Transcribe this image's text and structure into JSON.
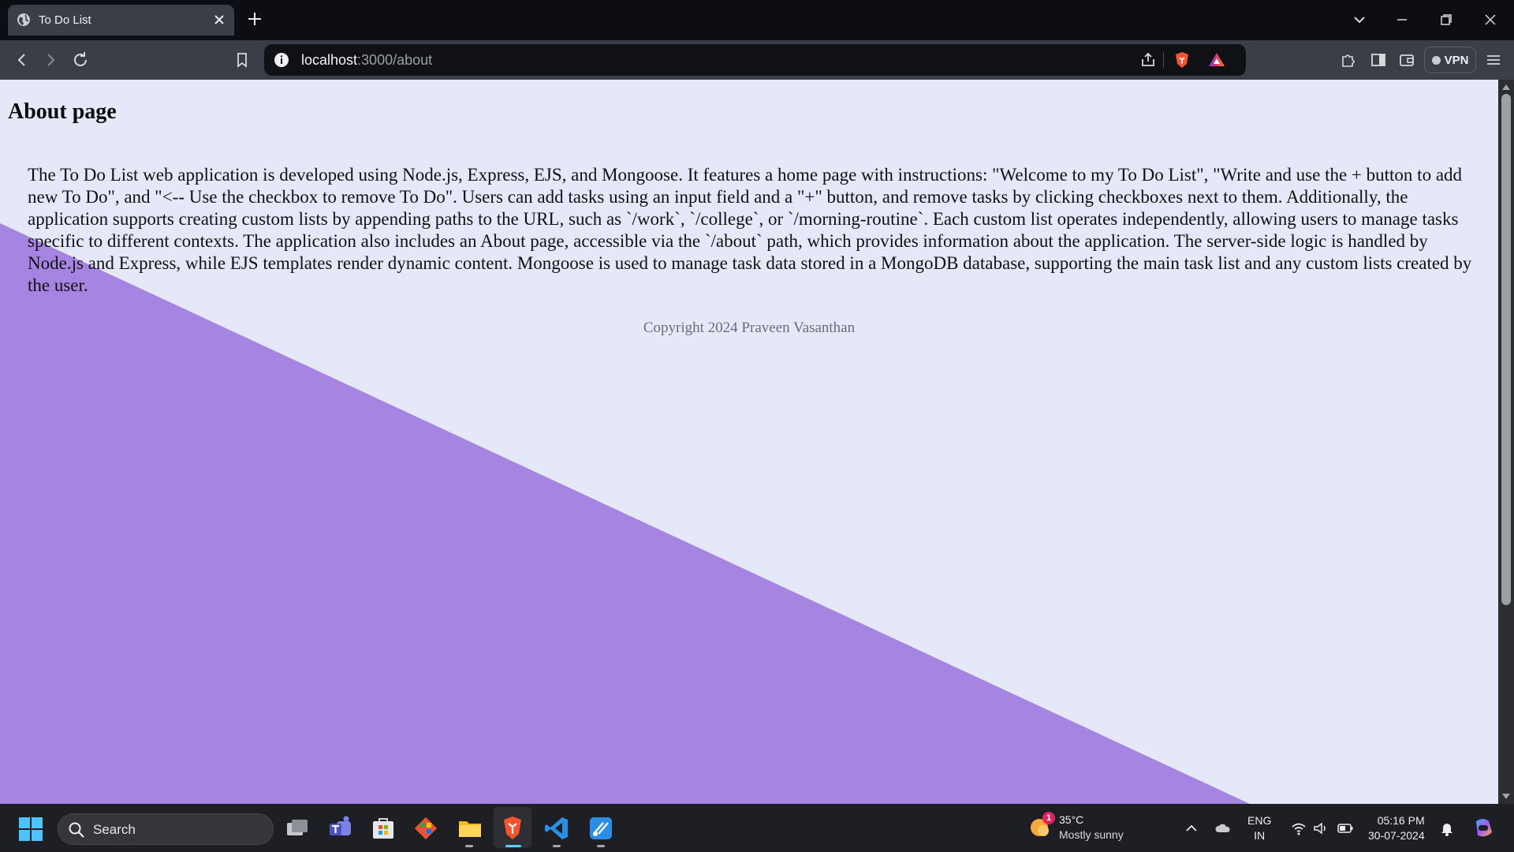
{
  "browser": {
    "tab_title": "To Do List",
    "url_host": "localhost",
    "url_rest": ":3000/about",
    "vpn_label": "VPN",
    "colors": {
      "tabstrip": "#0c0e13",
      "toolbar": "#3a3e46",
      "urlbar": "#0f1115"
    }
  },
  "page": {
    "heading": "About page",
    "body": "The To Do List web application is developed using Node.js, Express, EJS, and Mongoose. It features a home page with instructions: \"Welcome to my To Do List\", \"Write and use the + button to add new To Do\", and \"<-- Use the checkbox to remove To Do\". Users can add tasks using an input field and a \"+\" button, and remove tasks by clicking checkboxes next to them. Additionally, the application supports creating custom lists by appending paths to the URL, such as `/work`, `/college`, or `/morning-routine`. Each custom list operates independently, allowing users to manage tasks specific to different contexts. The application also includes an About page, accessible via the `/about` path, which provides information about the application. The server-side logic is handled by Node.js and Express, while EJS templates render dynamic content. Mongoose is used to manage task data stored in a MongoDB database, supporting the main task list and any custom lists created by the user.",
    "copyright": "Copyright 2024 Praveen Vasanthan",
    "colors": {
      "background": "#e4e8f9",
      "accent_shape": "#a685e2"
    }
  },
  "taskbar": {
    "search_placeholder": "Search",
    "apps": [
      "file-explorer-multitask",
      "teams",
      "microsoft-store",
      "git",
      "file-explorer",
      "brave",
      "vs-code",
      "snipping-tool"
    ],
    "weather": {
      "badge": "1",
      "temperature": "35°C",
      "condition": "Mostly sunny"
    },
    "language": {
      "lang": "ENG",
      "region": "IN"
    },
    "clock": {
      "time": "05:16 PM",
      "date": "30-07-2024"
    }
  }
}
